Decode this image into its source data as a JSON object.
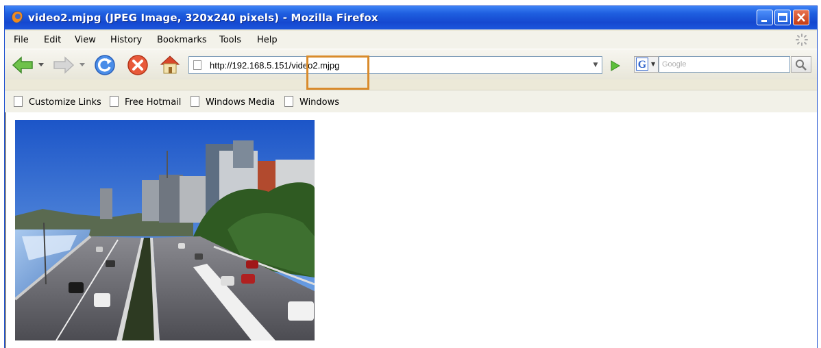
{
  "window": {
    "title": "video2.mjpg (JPEG Image, 320x240 pixels) - Mozilla Firefox"
  },
  "menu": [
    "File",
    "Edit",
    "View",
    "History",
    "Bookmarks",
    "Tools",
    "Help"
  ],
  "navigation": {
    "url": "http://192.168.5.151/video2.mjpg",
    "search_placeholder": "Google",
    "search_engine": "G"
  },
  "bookmarks": [
    "Customize Links",
    "Free Hotmail",
    "Windows Media",
    "Windows"
  ],
  "colors": {
    "titlebar": "#1548d0",
    "highlight": "#d98b2b"
  }
}
